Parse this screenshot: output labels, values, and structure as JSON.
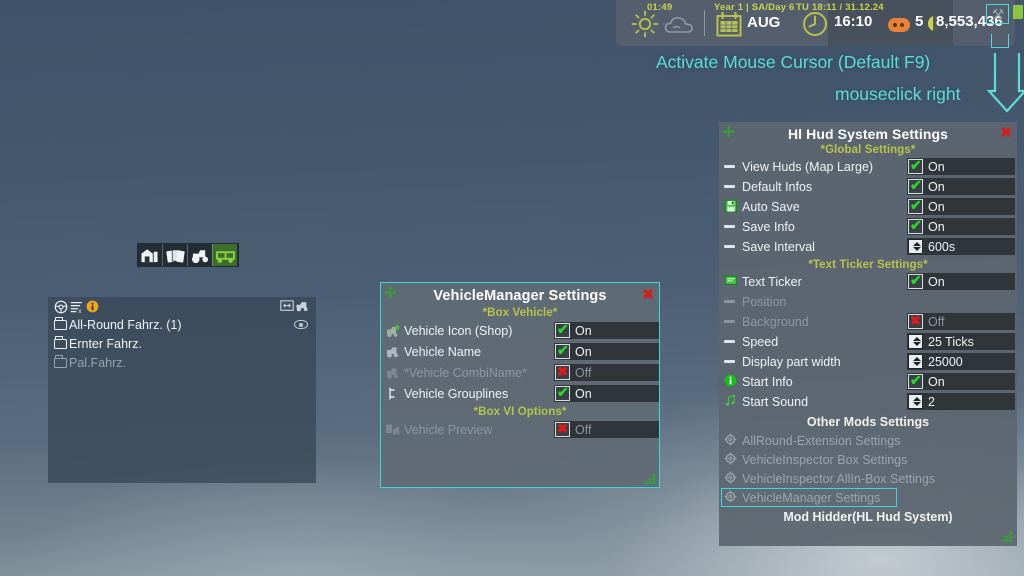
{
  "topbar": {
    "time_small": "01:49",
    "season_label": "Year 1 | SA/Day 6",
    "month": "AUG",
    "date_label": "TU 18:11 / 31.12.24",
    "clock_time": "16:10",
    "animal_count": "5",
    "money": "8,553,436",
    "icons": {
      "sun": "sun-icon",
      "cloud": "cloud-icon",
      "calendar": "calendar-icon",
      "clock": "clock-icon",
      "pig": "pig-icon",
      "coin": "coin-icon",
      "wrench": "wrench-icon"
    }
  },
  "hint": {
    "line1": "Activate Mouse Cursor (Default F9)",
    "line2": "mouseclick right",
    "color": "#5fdbd8"
  },
  "hl_window": {
    "title": "Hl Hud System Settings",
    "section_global": "*Global Settings*",
    "section_ticker": "*Text Ticker Settings*",
    "section_other": "Other Mods Settings",
    "footer": "Mod Hidder(HL Hud System)",
    "close_label": "✖",
    "global_rows": [
      {
        "icon": "dash-icon",
        "label": "View Huds (Map Large)",
        "control": "check",
        "state": "on",
        "value": "On",
        "dim": false
      },
      {
        "icon": "dash-icon",
        "label": "Default Infos",
        "control": "check",
        "state": "on",
        "value": "On",
        "dim": false
      },
      {
        "icon": "save-icon",
        "label": "Auto Save",
        "control": "check",
        "state": "on",
        "value": "On",
        "dim": false
      },
      {
        "icon": "dash-icon",
        "label": "Save Info",
        "control": "check",
        "state": "on",
        "value": "On",
        "dim": false
      },
      {
        "icon": "dash-icon",
        "label": "Save Interval",
        "control": "spin",
        "state": "",
        "value": "600s",
        "dim": false
      }
    ],
    "ticker_rows": [
      {
        "icon": "ticker-icon",
        "label": "Text Ticker",
        "control": "check",
        "state": "on",
        "value": "On",
        "dim": false
      },
      {
        "icon": "dash-icon",
        "label": "Position",
        "control": "none",
        "state": "",
        "value": "",
        "dim": true
      },
      {
        "icon": "dash-icon",
        "label": "Background",
        "control": "check",
        "state": "off",
        "value": "Off",
        "dim": true
      },
      {
        "icon": "dash-icon",
        "label": "Speed",
        "control": "spin",
        "state": "",
        "value": "25 Ticks",
        "dim": false
      },
      {
        "icon": "dash-icon",
        "label": "Display part width",
        "control": "spin",
        "state": "",
        "value": "25000",
        "dim": false
      },
      {
        "icon": "info-icon",
        "label": "Start Info",
        "control": "check",
        "state": "on",
        "value": "On",
        "dim": false
      },
      {
        "icon": "sound-icon",
        "label": "Start Sound",
        "control": "spin",
        "state": "",
        "value": "2",
        "dim": false
      }
    ],
    "mod_items": [
      {
        "icon": "gear-icon",
        "label": "AllRound-Extension Settings",
        "selected": false
      },
      {
        "icon": "gear-icon",
        "label": "VehicleInspector Box Settings",
        "selected": false
      },
      {
        "icon": "gear-icon",
        "label": "VehicleInspector AllIn-Box Settings",
        "selected": false
      },
      {
        "icon": "gear-icon",
        "label": "VehicleManager Settings",
        "selected": true
      }
    ]
  },
  "vm_window": {
    "title": "VehicleManager Settings",
    "section_box_vehicle": "*Box Vehicle*",
    "section_box_vi": "*Box VI Options*",
    "close_label": "✖",
    "rows": [
      {
        "icon": "shop-icon",
        "label": "Vehicle Icon (Shop)",
        "control": "check",
        "state": "on",
        "value": "On",
        "dim": false
      },
      {
        "icon": "vehicle-icon",
        "label": "Vehicle Name",
        "control": "check",
        "state": "on",
        "value": "On",
        "dim": false
      },
      {
        "icon": "vehicle-icon",
        "label": "*Vehicle CombiName*",
        "control": "check",
        "state": "off",
        "value": "Off",
        "dim": true
      },
      {
        "icon": "grouplines-icon",
        "label": "Vehicle Grouplines",
        "control": "check",
        "state": "on",
        "value": "On",
        "dim": false
      }
    ],
    "rows2": [
      {
        "icon": "preview-icon",
        "label": "Vehicle Preview",
        "control": "check",
        "state": "off",
        "value": "Off",
        "dim": true
      }
    ]
  },
  "vehicle_list": {
    "header_icons": [
      "steering-wheel-icon",
      "list-clear-icon",
      "info-icon"
    ],
    "header_right_icons": [
      "resize-icon",
      "vehicle-icon"
    ],
    "eye_icon": "eye-icon",
    "items": [
      {
        "label": "All-Round Fahrz. (1)",
        "dim": false
      },
      {
        "label": "Ernter Fahrz.",
        "dim": false
      },
      {
        "label": "Pal.Fahrz.",
        "dim": true
      }
    ]
  },
  "tool_strip": {
    "cells": [
      {
        "icon": "shop-building-icon",
        "active": false
      },
      {
        "icon": "cards-icon",
        "active": false
      },
      {
        "icon": "tractor-icon",
        "active": false
      },
      {
        "icon": "vehicle-list-icon",
        "active": true
      }
    ]
  }
}
